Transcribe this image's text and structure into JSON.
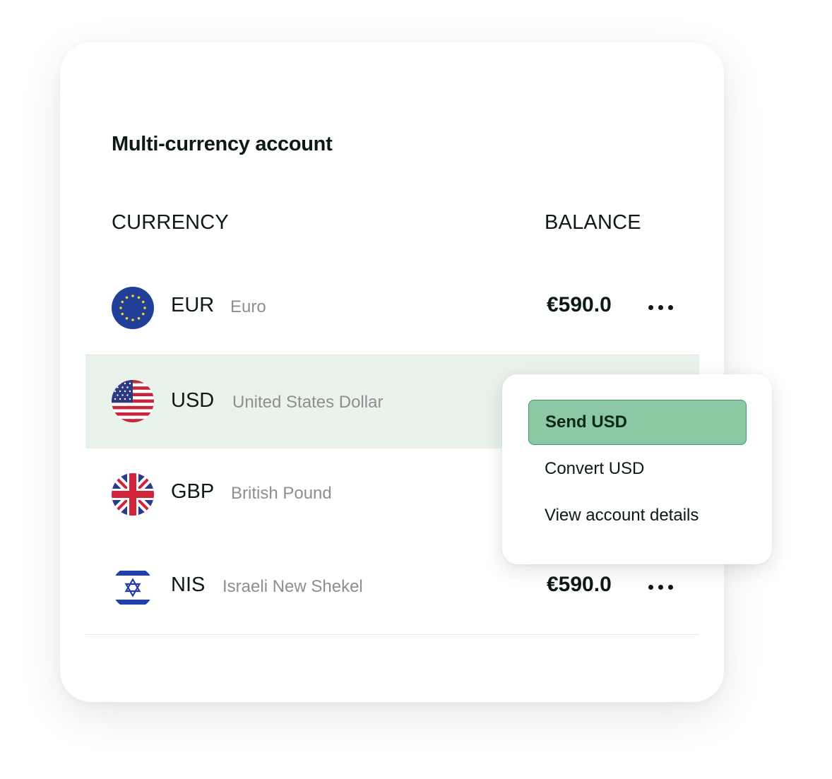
{
  "card": {
    "title": "Multi-currency account",
    "columns": {
      "currency": "CURRENCY",
      "balance": "BALANCE"
    }
  },
  "rows": [
    {
      "code": "EUR",
      "name": "Euro",
      "balance": "€590.0",
      "flag_icon": "eu-flag-icon",
      "highlighted": false
    },
    {
      "code": "USD",
      "name": "United States Dollar",
      "balance": "",
      "flag_icon": "us-flag-icon",
      "highlighted": true
    },
    {
      "code": "GBP",
      "name": "British Pound",
      "balance": "",
      "flag_icon": "uk-flag-icon",
      "highlighted": false
    },
    {
      "code": "NIS",
      "name": "Israeli New Shekel",
      "balance": "€590.0",
      "flag_icon": "israel-flag-icon",
      "highlighted": false
    }
  ],
  "menu": {
    "items": [
      {
        "label": "Send USD",
        "active": true
      },
      {
        "label": "Convert USD",
        "active": false
      },
      {
        "label": "View account details",
        "active": false
      }
    ]
  },
  "colors": {
    "highlight_row": "#e9f3ec",
    "menu_active_bg": "#8cc8a4",
    "menu_active_border": "#3e9a62",
    "text_primary": "#0d1a14",
    "text_secondary": "#8d8f8e"
  }
}
